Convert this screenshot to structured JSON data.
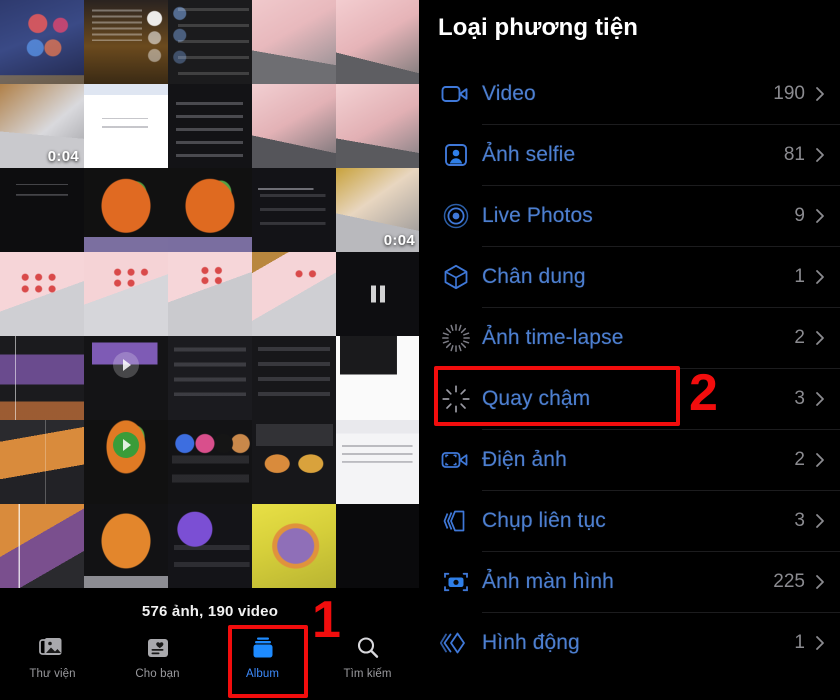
{
  "colors": {
    "accent_blue": "#3d8bfd",
    "list_text_blue": "#4d7fd0",
    "count_gray": "#8b8b90",
    "annotation_red": "#f20d0d",
    "background": "#000000",
    "separator": "#1c1c1e"
  },
  "photos_panel": {
    "count_line": "576 ảnh, 190 video",
    "video_durations": [
      "0:04",
      "0:04"
    ],
    "tabs": [
      {
        "label": "Thư viện",
        "icon": "photo-stack-icon",
        "active": false
      },
      {
        "label": "Cho bạn",
        "icon": "for-you-card-icon",
        "active": false
      },
      {
        "label": "Album",
        "icon": "albums-icon",
        "active": true
      },
      {
        "label": "Tìm kiếm",
        "icon": "search-icon",
        "active": false
      }
    ]
  },
  "media_type_panel": {
    "title": "Loại phương tiện",
    "items": [
      {
        "label": "Video",
        "count": "190",
        "icon": "video-camera-icon"
      },
      {
        "label": "Ảnh selfie",
        "count": "81",
        "icon": "selfie-person-icon"
      },
      {
        "label": "Live Photos",
        "count": "9",
        "icon": "live-photo-rings-icon"
      },
      {
        "label": "Chân dung",
        "count": "1",
        "icon": "portrait-cube-icon"
      },
      {
        "label": "Ảnh time-lapse",
        "count": "2",
        "icon": "timelapse-sunburst-icon"
      },
      {
        "label": "Quay chậm",
        "count": "3",
        "icon": "slomo-sunburst-icon"
      },
      {
        "label": "Điện ảnh",
        "count": "2",
        "icon": "cinematic-video-icon"
      },
      {
        "label": "Chụp liên tục",
        "count": "3",
        "icon": "burst-stack-icon"
      },
      {
        "label": "Ảnh màn hình",
        "count": "225",
        "icon": "screenshot-camera-icon"
      },
      {
        "label": "Hình động",
        "count": "1",
        "icon": "animated-chevrons-icon"
      }
    ]
  },
  "annotations": [
    {
      "number": "1",
      "target": "albums-tab"
    },
    {
      "number": "2",
      "target": "quay-cham-row"
    }
  ]
}
